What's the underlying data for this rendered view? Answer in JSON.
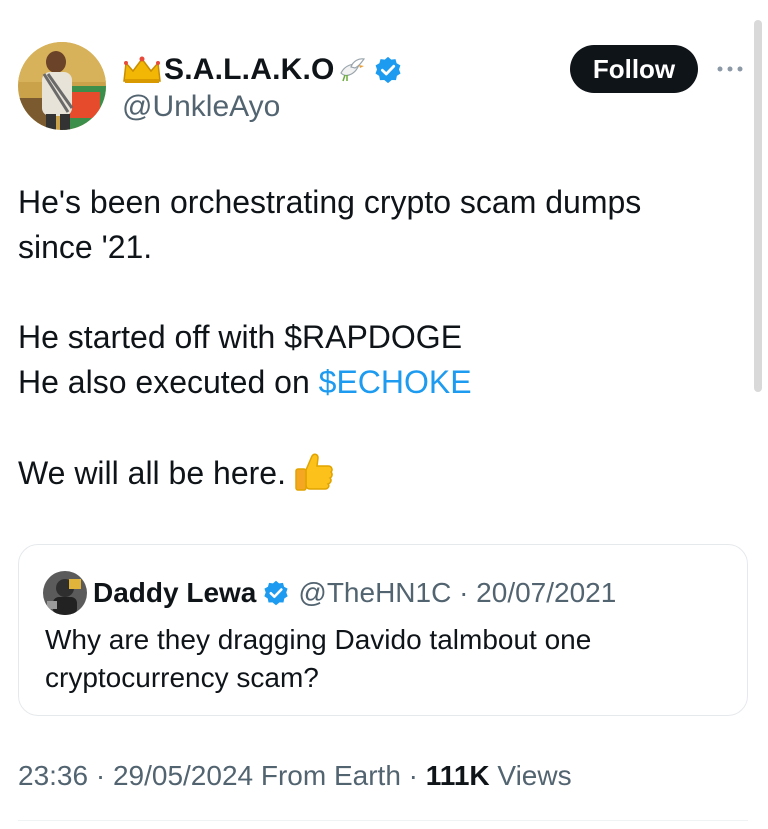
{
  "author": {
    "display_name": "S.A.L.A.K.O",
    "handle": "@UnkleAyo",
    "verified": true,
    "name_prefix_icon": "crown-icon",
    "name_suffix_icon": "dove-icon"
  },
  "actions": {
    "follow_label": "Follow",
    "more_icon": "more-dots-icon"
  },
  "tweet": {
    "line1": "He's been orchestrating crypto scam dumps",
    "line2": "since '21.",
    "line3": "He started off with $RAPDOGE",
    "line4_prefix": "He also executed on ",
    "line4_cashtag": "$ECHOKE",
    "line5": "We will all be here.",
    "emoji_icon": "thumbs-up-icon"
  },
  "quote": {
    "display_name": "Daddy Lewa",
    "handle_date": "@TheHN1C · 20/07/2021",
    "verified": true,
    "text": "Why are they dragging Davido talmbout one cryptocurrency scam?"
  },
  "meta": {
    "timestamp": "23:36 · 29/05/2024 From Earth · ",
    "views_count": "111K",
    "views_label": " Views"
  },
  "colors": {
    "link": "#1d9bf0",
    "verified": "#1d9bf0",
    "secondary_text": "#536471",
    "primary_text": "#0f1419",
    "follow_bg": "#0f1419"
  }
}
